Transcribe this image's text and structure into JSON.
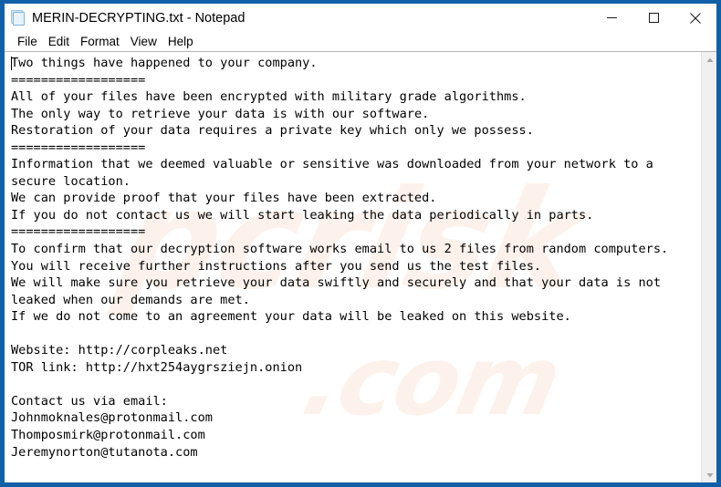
{
  "window": {
    "title": "MERIN-DECRYPTING.txt - Notepad",
    "icon": "notepad-document-icon",
    "border_color": "#1060a8",
    "background": "#ffffff"
  },
  "controls": {
    "minimize": "minimize-icon",
    "maximize": "maximize-icon",
    "close": "close-icon"
  },
  "menu": {
    "items": [
      {
        "label": "File"
      },
      {
        "label": "Edit"
      },
      {
        "label": "Format"
      },
      {
        "label": "View"
      },
      {
        "label": "Help"
      }
    ]
  },
  "document": {
    "text": "Two things have happened to your company.\n==================\nAll of your files have been encrypted with military grade algorithms.\nThe only way to retrieve your data is with our software.\nRestoration of your data requires a private key which only we possess.\n==================\nInformation that we deemed valuable or sensitive was downloaded from your network to a secure location.\nWe can provide proof that your files have been extracted.\nIf you do not contact us we will start leaking the data periodically in parts.\n==================\nTo confirm that our decryption software works email to us 2 files from random computers.\nYou will receive further instructions after you send us the test files.\nWe will make sure you retrieve your data swiftly and securely and that your data is not leaked when our demands are met.\nIf we do not come to an agreement your data will be leaked on this website.\n\nWebsite: http://corpleaks.net\nTOR link: http://hxt254aygrsziejn.onion\n\nContact us via email:\nJohnmoknales@protonmail.com\nThomposmirk@protonmail.com\nJeremynorton@tutanota.com",
    "separator": "==================",
    "website": "http://corpleaks.net",
    "tor_link": "http://hxt254aygrsziejn.onion",
    "emails": [
      "Johnmoknales@protonmail.com",
      "Thomposmirk@protonmail.com",
      "Jeremynorton@tutanota.com"
    ]
  },
  "scrollbar": {
    "up_arrow": "scroll-up-arrow-icon",
    "down_arrow": "scroll-down-arrow-icon"
  },
  "watermark": {
    "text_primary": ".com",
    "text_secondary": "pcrisk",
    "color": "#f2a06a"
  }
}
